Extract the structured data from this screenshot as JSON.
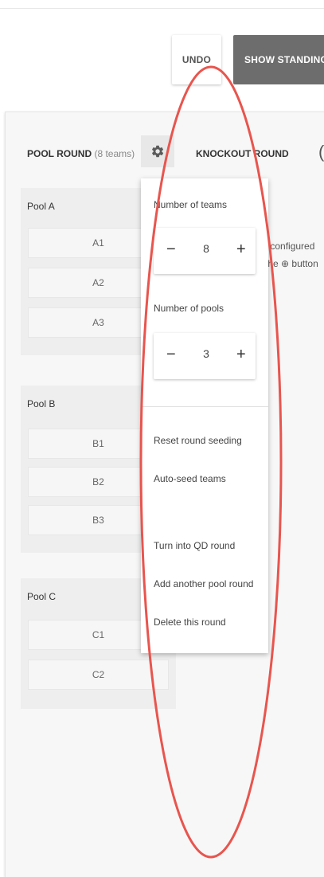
{
  "toolbar": {
    "undo_label": "UNDO",
    "show_standings_label": "SHOW STANDINGS"
  },
  "rounds": {
    "pool_round_label": "POOL ROUND",
    "pool_round_teams": "(8 teams)",
    "knockout_round_label": "KNOCKOUT ROUND",
    "partial_glyph": "(",
    "note_line1": "und configured",
    "note_line2": "n the ⊕ button"
  },
  "pools": [
    {
      "name": "Pool A",
      "slots": [
        "A1",
        "A2",
        "A3"
      ]
    },
    {
      "name": "Pool B",
      "slots": [
        "B1",
        "B2",
        "B3"
      ]
    },
    {
      "name": "Pool C",
      "slots": [
        "C1",
        "C2"
      ]
    }
  ],
  "settings_menu": {
    "teams_label": "Number of teams",
    "teams_value": "8",
    "pools_label": "Number of pools",
    "pools_value": "3",
    "minus_glyph": "−",
    "plus_glyph": "+",
    "items": [
      "Reset round seeding",
      "Auto-seed teams",
      "Turn into QD round",
      "Add another pool round",
      "Delete this round"
    ]
  },
  "colors": {
    "annotation_red": "#e8554e",
    "standings_bg": "#6d6d6d"
  },
  "icons": {
    "settings": "gear-icon"
  }
}
